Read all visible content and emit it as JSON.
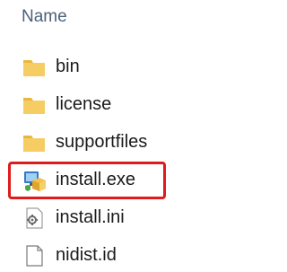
{
  "header": {
    "name_label": "Name"
  },
  "files": [
    {
      "name": "bin",
      "icon": "folder-icon"
    },
    {
      "name": "license",
      "icon": "folder-icon"
    },
    {
      "name": "supportfiles",
      "icon": "folder-icon"
    },
    {
      "name": "install.exe",
      "icon": "installer-exe-icon",
      "highlighted": true
    },
    {
      "name": "install.ini",
      "icon": "settings-file-icon"
    },
    {
      "name": "nidist.id",
      "icon": "blank-file-icon"
    }
  ],
  "colors": {
    "header_text": "#4c607a",
    "folder": "#f3c65b",
    "highlight_border": "#e01b1b"
  }
}
